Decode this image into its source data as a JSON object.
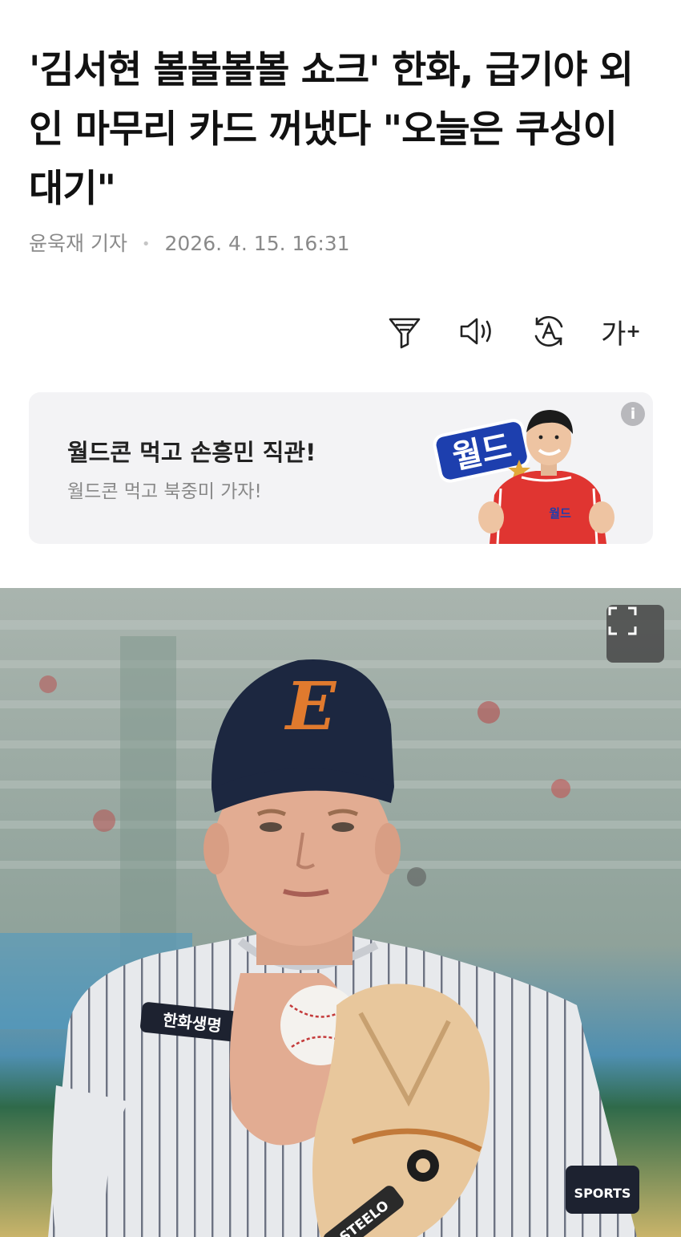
{
  "article": {
    "headline": "'김서현 볼볼볼볼 쇼크' 한화, 급기야 외인 마무리 카드 꺼냈다 \"오늘은 쿠싱이 대기\"",
    "reporter": "윤욱재 기자",
    "date": "2026. 4. 15. 16:31"
  },
  "toolbar": {
    "items": [
      {
        "name": "filter-icon"
      },
      {
        "name": "speaker-icon"
      },
      {
        "name": "translate-icon"
      },
      {
        "name": "font-size-icon",
        "label": "가",
        "suffix": "+"
      }
    ]
  },
  "ad": {
    "title": "월드콘 먹고 손흥민 직관!",
    "subtitle": "월드콘 먹고 북중미 가자!",
    "info_label": "i",
    "logo_text": "월드",
    "jersey_text": "월드"
  },
  "photo": {
    "cap_letter": "E",
    "jersey_sponsor": "한화생명",
    "glove_brand": "STEELO",
    "patch_text": "SPORTS"
  },
  "colors": {
    "text_primary": "#111111",
    "text_muted": "#8a8a8a",
    "ad_background": "#f3f3f5",
    "cap_navy": "#1c2740",
    "cap_logo_orange": "#e07a2e"
  }
}
